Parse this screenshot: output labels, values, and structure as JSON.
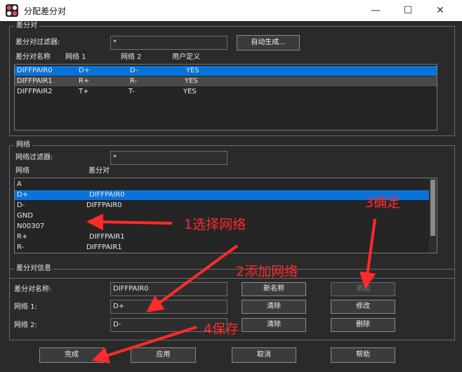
{
  "window": {
    "title": "分配差分对",
    "minimize_glyph": "—",
    "maximize_glyph": "☐",
    "close_glyph": "✕"
  },
  "diffpairs_group": {
    "title": "差分对",
    "filter_label": "差分对过滤器:",
    "filter_value": "*",
    "auto_generate_button": "自动生成...",
    "columns": [
      "差分对名称",
      "网络 1",
      "网络 2",
      "用户定义"
    ],
    "rows": [
      {
        "name": "DIFFPAIR0",
        "net1": "D+",
        "net2": "D-",
        "user": "YES",
        "selected": true
      },
      {
        "name": "DIFFPAIR1",
        "net1": "R+",
        "net2": "R-",
        "user": "YES",
        "selected": false
      },
      {
        "name": "DIFFPAIR2",
        "net1": "T+",
        "net2": "T-",
        "user": "YES",
        "selected": false
      }
    ]
  },
  "nets_group": {
    "title": "网络",
    "filter_label": "网络过滤器:",
    "filter_value": "*",
    "columns": [
      "网络",
      "差分对"
    ],
    "rows": [
      {
        "net": "A",
        "pair": "",
        "selected": false
      },
      {
        "net": "D+",
        "pair": "DIFFPAIR0",
        "selected": true
      },
      {
        "net": "D-",
        "pair": "DIFFPAIR0",
        "selected": false
      },
      {
        "net": "GND",
        "pair": "",
        "selected": false
      },
      {
        "net": "N00307",
        "pair": "",
        "selected": false
      },
      {
        "net": "R+",
        "pair": "DIFFPAIR1",
        "selected": false
      },
      {
        "net": "R-",
        "pair": "DIFFPAIR1",
        "selected": false
      }
    ]
  },
  "info_group": {
    "title": "差分对信息",
    "name_label": "差分对名称:",
    "name_value": "DIFFPAIR0",
    "net1_label": "网络 1:",
    "net1_value": "D+",
    "net2_label": "网络 2:",
    "net2_value": "D-",
    "new_name_button": "新名称",
    "clear1_button": "清除",
    "clear2_button": "清除",
    "add_button": "添加",
    "modify_button": "修改",
    "delete_button": "删除"
  },
  "footer": {
    "ok_button": "完成",
    "apply_button": "应用",
    "cancel_button": "取消",
    "help_button": "帮助"
  },
  "annotations": {
    "step1": "1选择网络",
    "step2": "2添加网络",
    "step3": "3确定",
    "step4": "4保存",
    "color": "#ff2a2a"
  },
  "colors": {
    "selection": "#0a73d9",
    "background": "#2a2a2a"
  }
}
